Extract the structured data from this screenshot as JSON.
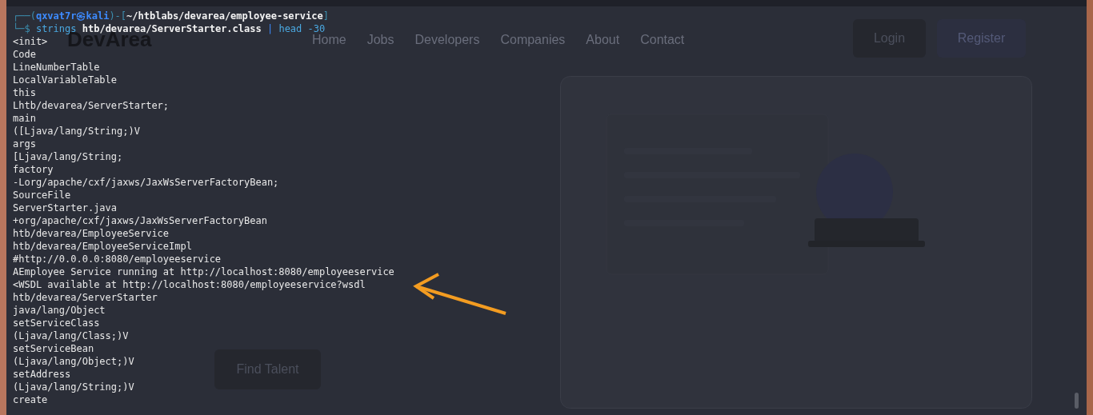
{
  "website": {
    "logo": "DevArea",
    "nav": [
      "Home",
      "Jobs",
      "Developers",
      "Companies",
      "About",
      "Contact"
    ],
    "login": "Login",
    "register": "Register",
    "secondary_cta": "Find Talent"
  },
  "terminal": {
    "prompt": [
      {
        "kind": "frame",
        "text": "┌──("
      },
      {
        "kind": "user",
        "text": "qxvat7r㉿kali"
      },
      {
        "kind": "frame",
        "text": ")-["
      },
      {
        "kind": "path",
        "text": "~/htblabs/devarea/employee-service"
      },
      {
        "kind": "frame",
        "text": "]"
      }
    ],
    "command": [
      {
        "kind": "frame",
        "text": "└─$"
      },
      {
        "kind": "program",
        "text": "strings"
      },
      {
        "kind": "arg",
        "text": "htb/devarea/ServerStarter.class"
      },
      {
        "kind": "pipe",
        "text": "|"
      },
      {
        "kind": "program",
        "text": "head"
      },
      {
        "kind": "flag",
        "text": "-30"
      }
    ],
    "output": [
      "<init>",
      "Code",
      "LineNumberTable",
      "LocalVariableTable",
      "this",
      "Lhtb/devarea/ServerStarter;",
      "main",
      "([Ljava/lang/String;)V",
      "args",
      "[Ljava/lang/String;",
      "factory",
      "-Lorg/apache/cxf/jaxws/JaxWsServerFactoryBean;",
      "SourceFile",
      "ServerStarter.java",
      "+org/apache/cxf/jaxws/JaxWsServerFactoryBean",
      "htb/devarea/EmployeeService",
      "htb/devarea/EmployeeServiceImpl",
      "#http://0.0.0.0:8080/employeeservice",
      "AEmployee Service running at http://localhost:8080/employeeservice",
      "<WSDL available at http://localhost:8080/employeeservice?wsdl",
      "htb/devarea/ServerStarter",
      "java/lang/Object",
      "setServiceClass",
      "(Ljava/lang/Class;)V",
      "setServiceBean",
      "(Ljava/lang/Object;)V",
      "setAddress",
      "(Ljava/lang/String;)V",
      "create"
    ]
  }
}
